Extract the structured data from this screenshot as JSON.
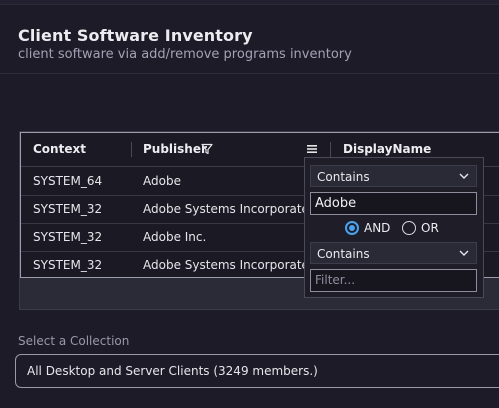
{
  "page": {
    "title": "Client Software Inventory",
    "subtitle": "client software via add/remove programs inventory"
  },
  "grid": {
    "columns": [
      {
        "label": "Context"
      },
      {
        "label": "Publisher",
        "filtered": true
      },
      {
        "label": "DisplayName"
      }
    ],
    "rows": [
      [
        "SYSTEM_64",
        "Adobe"
      ],
      [
        "SYSTEM_32",
        "Adobe Systems Incorporated"
      ],
      [
        "SYSTEM_32",
        "Adobe Inc."
      ],
      [
        "SYSTEM_32",
        "Adobe Systems Incorporated"
      ]
    ]
  },
  "filter_popup": {
    "condition1": "Contains",
    "value1": "Adobe",
    "operator_and": "AND",
    "operator_or": "OR",
    "selected_operator": "AND",
    "condition2": "Contains",
    "value2_placeholder": "Filter..."
  },
  "collection": {
    "label": "Select a Collection",
    "selected": "All Desktop and Server Clients (3249 members.)"
  },
  "colors": {
    "background": "#1d1b27",
    "accent": "#4aa3f0"
  }
}
